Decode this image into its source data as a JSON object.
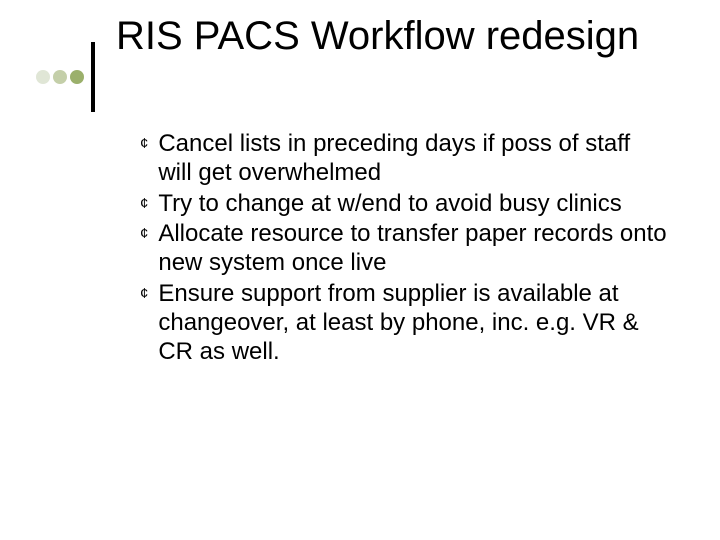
{
  "title": "RIS PACS Workflow redesign",
  "bullets": [
    "Cancel lists in preceding days if poss of staff will get overwhelmed",
    "Try to change at w/end to avoid busy clinics",
    "Allocate resource to transfer paper records onto new system once live",
    "Ensure support from supplier is available at changeover, at least by phone, inc. e.g. VR & CR as well."
  ]
}
